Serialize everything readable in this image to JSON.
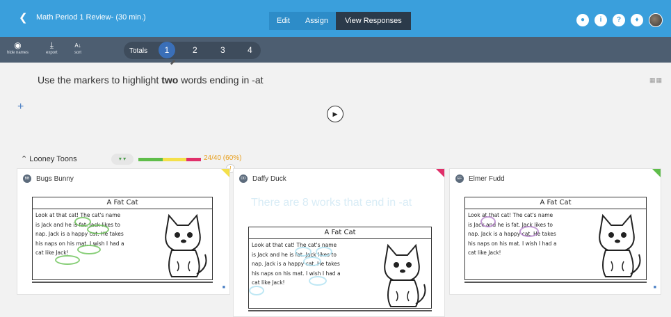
{
  "topbar": {
    "back_icon": "chevron-left-icon",
    "title": "Math Period 1 Review- (30 min.)",
    "modes": [
      "Edit",
      "Assign",
      "View Responses"
    ],
    "active_mode": "View Responses",
    "icons": [
      "eye-icon",
      "info-icon",
      "help-icon",
      "bell-icon",
      "avatar"
    ],
    "accent_color": "#3a9fdc"
  },
  "toolbar": {
    "hide_names": "hide names",
    "export": "export",
    "sort": "sort",
    "totals": "Totals",
    "questions": [
      "1",
      "2",
      "3",
      "4"
    ],
    "active_question": "1"
  },
  "prompt": {
    "before": "Use the markers to highlight ",
    "emphasis": "two",
    "after": " words ending in -at"
  },
  "group": {
    "name": "Looney Toons",
    "score": "24/40 (60%)",
    "progress_colors": [
      "#5fbd4a",
      "#f4e04a",
      "#e0306a"
    ]
  },
  "worksheet": {
    "title": "A Fat Cat",
    "lines": [
      "Look at that cat!  The cat's name",
      "is Jack and he is fat.  Jack likes to",
      "nap.  Jack is a happy cat.  He takes",
      "his naps on his mat.  I wish I had a",
      "cat like Jack!"
    ]
  },
  "cards": [
    {
      "name": "Bugs Bunny",
      "initials": "BB",
      "corner_color": "#f4e04a",
      "highlight_color": "#5fbd4a"
    },
    {
      "name": "Daffy Duck",
      "initials": "DD",
      "corner_color": "#e0306a",
      "highlight_color": "#a8dff0",
      "response_text": "There are 8 works that end in -at"
    },
    {
      "name": "Elmer Fudd",
      "initials": "EF",
      "corner_color": "#5fbd4a",
      "highlight_color": "#b07ac8"
    }
  ]
}
